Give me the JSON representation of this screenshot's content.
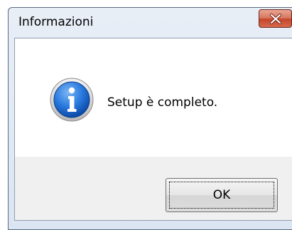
{
  "dialog": {
    "title": "Informazioni",
    "message": "Setup è completo.",
    "ok_label": "OK",
    "icon": "information-icon",
    "close_icon": "close-icon"
  },
  "colors": {
    "close_button": "#c4462c",
    "info_icon_blue": "#1f6fd1",
    "content_background": "#ffffff",
    "button_area_background": "#f0f0f0"
  }
}
